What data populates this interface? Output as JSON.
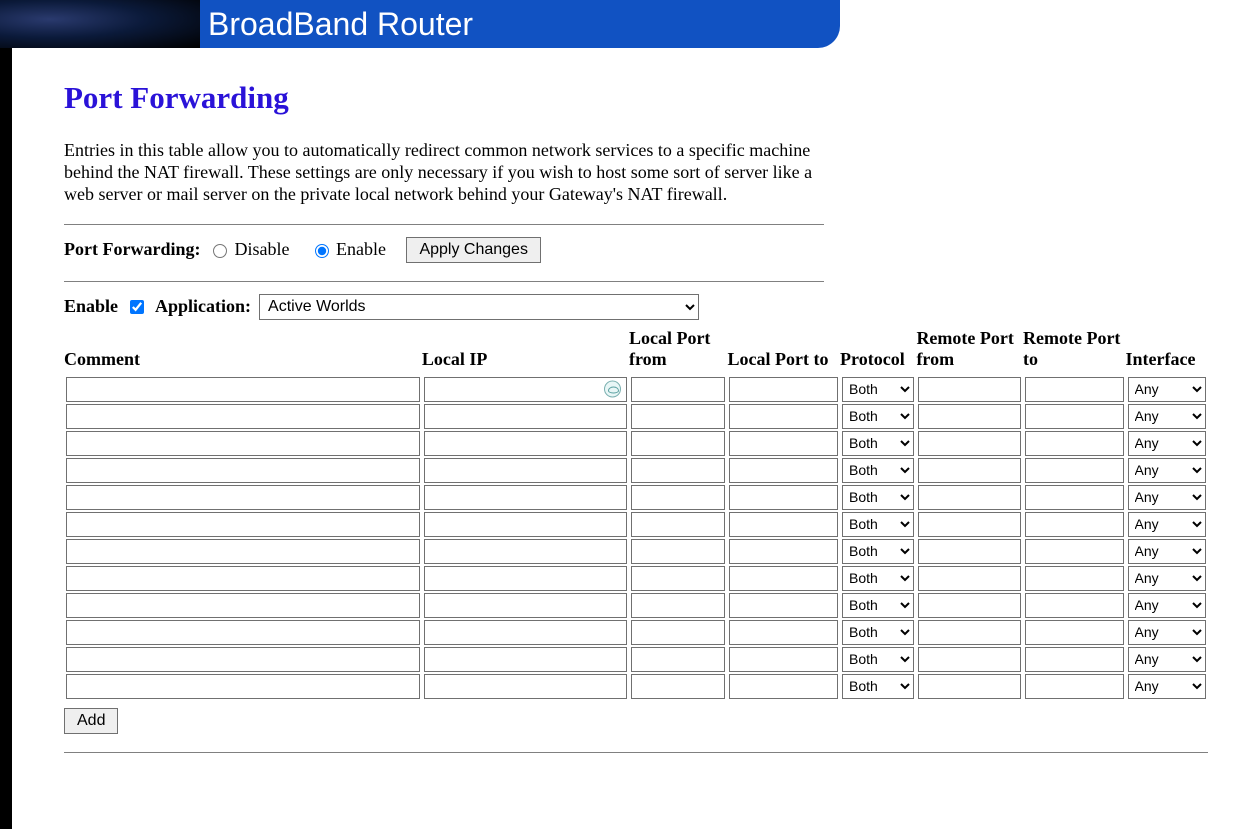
{
  "banner": {
    "title": "BroadBand Router"
  },
  "page": {
    "heading": "Port Forwarding",
    "intro": "Entries in this table allow you to automatically redirect common network services to a specific machine behind the NAT firewall. These settings are only necessary if you wish to host some sort of server like a web server or mail server on the private local network behind your Gateway's NAT firewall."
  },
  "mode_row": {
    "label": "Port Forwarding:",
    "disable_label": "Disable",
    "enable_label": "Enable",
    "selected": "enable",
    "apply_label": "Apply Changes"
  },
  "app_row": {
    "enable_label": "Enable",
    "enable_checked": true,
    "application_label": "Application:",
    "application_selected": "Active Worlds"
  },
  "table": {
    "headers": {
      "comment": "Comment",
      "local_ip": "Local IP",
      "local_port_from": "Local Port from",
      "local_port_to": "Local Port to",
      "protocol": "Protocol",
      "remote_port_from": "Remote Port from",
      "remote_port_to": "Remote Port to",
      "interface": "Interface"
    },
    "protocol_default": "Both",
    "interface_default": "Any",
    "row_count": 12
  },
  "buttons": {
    "add_label": "Add"
  }
}
